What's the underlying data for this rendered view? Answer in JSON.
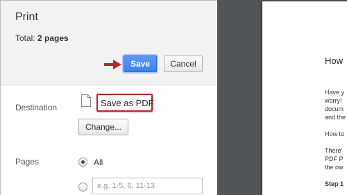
{
  "header": {
    "title": "Print",
    "total_label": "Total: ",
    "total_value": "2 pages"
  },
  "buttons": {
    "save": "Save",
    "cancel": "Cancel",
    "change": "Change..."
  },
  "destination": {
    "label": "Destination",
    "value": "Save as PDF"
  },
  "pages": {
    "label": "Pages",
    "option_all": "All",
    "placeholder": "e.g. 1-5, 8, 11-13",
    "selected": "All"
  },
  "preview": {
    "heading": "How",
    "lines": [
      "Have y",
      "worry!",
      "docum",
      "and the",
      "How to",
      "There'",
      "PDF P",
      "the ow",
      "Step 1"
    ]
  },
  "colors": {
    "accent": "#4d8ff0",
    "highlight": "#b8272c",
    "preview_bg": "#525659"
  }
}
